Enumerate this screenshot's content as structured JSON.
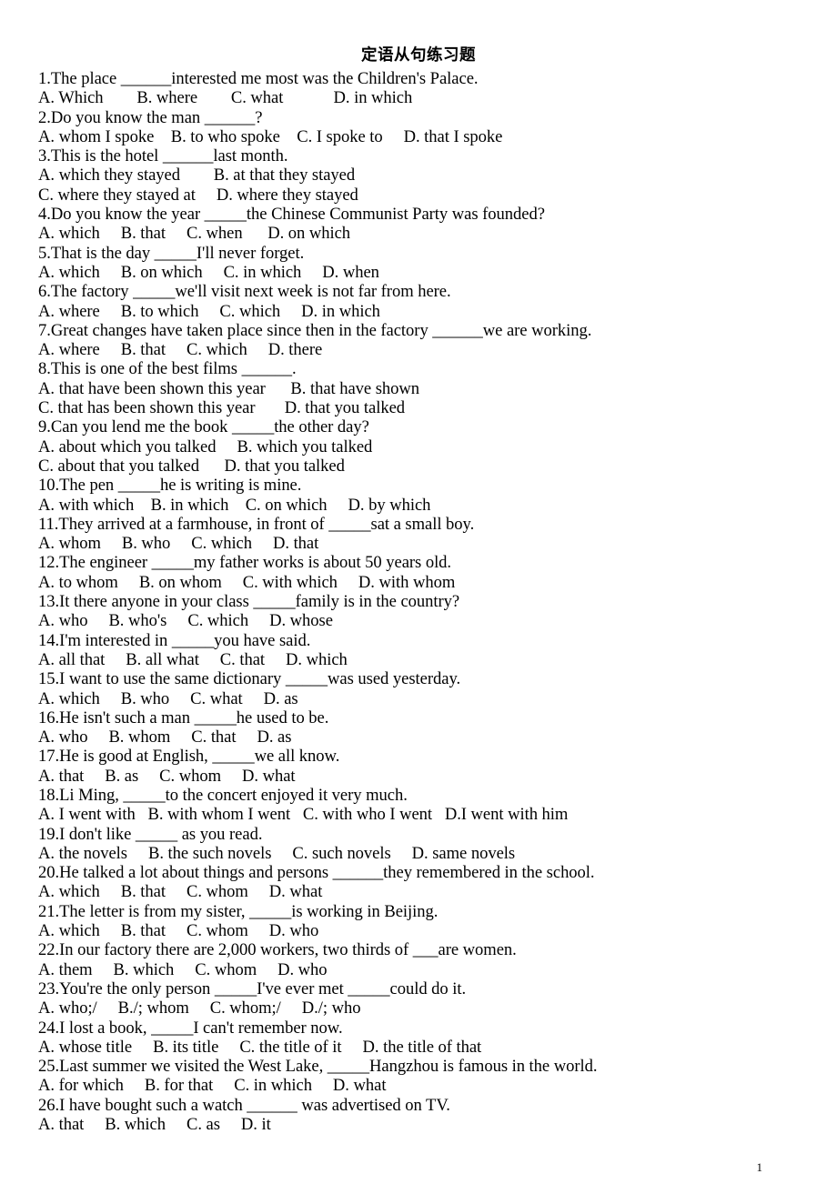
{
  "document": {
    "title": "定语从句练习题",
    "page_number": "1",
    "lines": [
      "1.The place ______interested me most was the Children's Palace.",
      "A. Which        B. where        C. what            D. in which",
      "2.Do you know the man ______?",
      "A. whom I spoke    B. to who spoke    C. I spoke to     D. that I spoke",
      "3.This is the hotel ______last month.",
      "A. which they stayed        B. at that they stayed",
      "C. where they stayed at     D. where they stayed",
      "4.Do you know the year _____the Chinese Communist Party was founded?",
      "A. which     B. that     C. when      D. on which",
      "5.That is the day _____I'll never forget.",
      "A. which     B. on which     C. in which     D. when",
      "6.The factory _____we'll visit next week is not far from here.",
      "A. where     B. to which     C. which     D. in which",
      "7.Great changes have taken place since then in the factory ______we are working.",
      "A. where     B. that     C. which     D. there",
      "8.This is one of the best films ______.",
      "A. that have been shown this year      B. that have shown",
      "C. that has been shown this year       D. that you talked",
      "9.Can you lend me the book _____the other day?",
      "A. about which you talked     B. which you talked",
      "C. about that you talked      D. that you talked",
      "10.The pen _____he is writing is mine.",
      "A. with which    B. in which    C. on which     D. by which",
      "11.They arrived at a farmhouse, in front of _____sat a small boy.",
      "A. whom     B. who     C. which     D. that",
      "12.The engineer _____my father works is about 50 years old.",
      "A. to whom     B. on whom     C. with which     D. with whom",
      "13.It there anyone in your class _____family is in the country?",
      "A. who     B. who's     C. which     D. whose",
      "14.I'm interested in _____you have said.",
      "A. all that     B. all what     C. that     D. which",
      "15.I want to use the same dictionary _____was used yesterday.",
      "A. which     B. who     C. what     D. as",
      "16.He isn't such a man _____he used to be.",
      "A. who     B. whom     C. that     D. as",
      "17.He is good at English, _____we all know.",
      "A. that     B. as     C. whom     D. what",
      "18.Li Ming, _____to the concert enjoyed it very much.",
      "A. I went with   B. with whom I went   C. with who I went   D.I went with him",
      "19.I don't like _____ as you read.",
      "A. the novels     B. the such novels     C. such novels     D. same novels",
      "20.He talked a lot about things and persons ______they remembered in the school.",
      "A. which     B. that     C. whom     D. what",
      "21.The letter is from my sister, _____is working in Beijing.",
      "A. which     B. that     C. whom     D. who",
      "22.In our factory there are 2,000 workers, two thirds of ___are women.",
      "A. them     B. which     C. whom     D. who",
      "23.You're the only person _____I've ever met _____could do it.",
      "A. who;/     B./; whom     C. whom;/     D./; who",
      "24.I lost a book, _____I can't remember now.",
      "A. whose title     B. its title     C. the title of it     D. the title of that",
      "25.Last summer we visited the West Lake, _____Hangzhou is famous in the world.",
      "A. for which     B. for that     C. in which     D. what",
      "26.I have bought such a watch ______ was advertised on TV.",
      "A. that     B. which     C. as     D. it"
    ]
  }
}
